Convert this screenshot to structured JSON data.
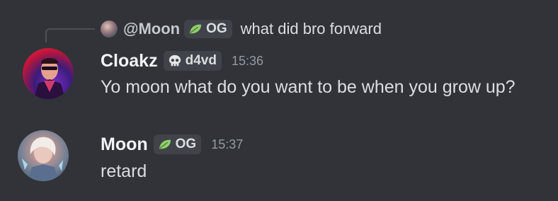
{
  "reply": {
    "author": "@Moon",
    "role_tag": "OG",
    "role_icon": "leaf-icon",
    "text": "what did bro forward"
  },
  "messages": [
    {
      "author": "Cloakz",
      "role_tag": "d4vd",
      "role_icon": "skull-icon",
      "time": "15:36",
      "text": "Yo moon what do you want to be when you grow up?"
    },
    {
      "author": "Moon",
      "role_tag": "OG",
      "role_icon": "leaf-icon",
      "time": "15:37",
      "text": "retard"
    }
  ],
  "colors": {
    "background": "#313338",
    "tag_background": "#41434a",
    "leaf_green": "#8fcf6a"
  }
}
